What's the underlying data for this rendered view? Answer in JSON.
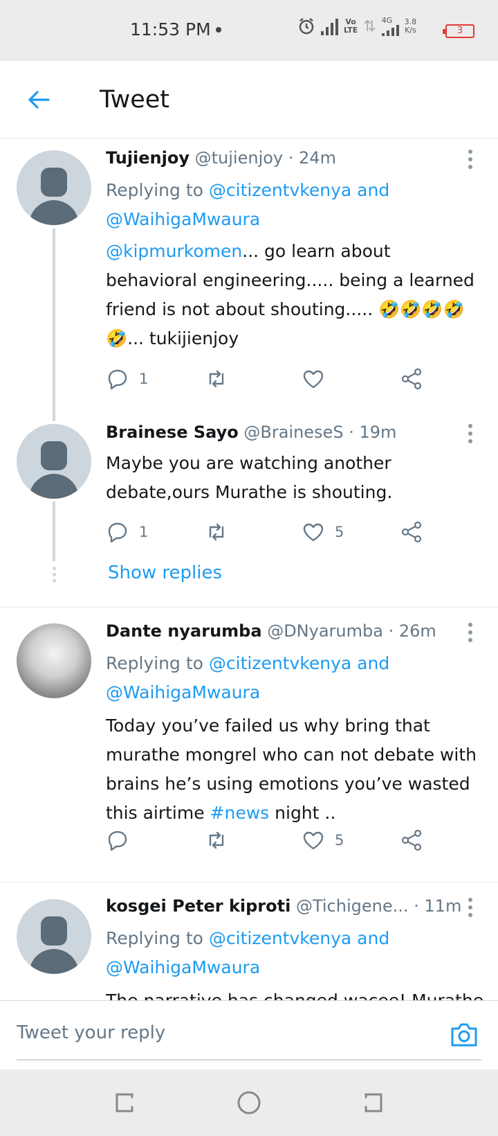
{
  "status_bar": {
    "time": "11:53 PM",
    "network_type": "4G",
    "volte_label": "Vo\nLTE",
    "speed": "3.8\nK/s",
    "battery": "3"
  },
  "header": {
    "title": "Tweet"
  },
  "tweets": [
    {
      "name": "Tujienjoy",
      "handle": "@tujienjoy",
      "time": "· 24m",
      "replying_prefix": "Replying to ",
      "replying_to": "@citizentvkenya and @WaihigaMwaura",
      "mention": "@kipmurkomen",
      "text": "... go learn about behavioral engineering..... being a learned friend is not about shouting..... 🤣🤣🤣🤣🤣... tukijienjoy",
      "reply_count": "1",
      "retweet_count": "",
      "like_count": ""
    },
    {
      "name": "Brainese Sayo",
      "handle": "@BraineseS",
      "time": "· 19m",
      "text": "Maybe you are watching another debate,ours Murathe is shouting.",
      "reply_count": "1",
      "retweet_count": "",
      "like_count": "5",
      "show_replies": "Show replies"
    },
    {
      "name": "Dante nyarumba",
      "handle": "@DNyarumba",
      "time": "· 26m",
      "replying_prefix": "Replying to ",
      "replying_to": "@citizentvkenya and @WaihigaMwaura",
      "text_before": "Today you’ve failed us why bring that murathe mongrel who can not debate with brains he’s using emotions you’ve wasted this airtime ",
      "hashtag": "#news",
      "text_after": " night ..",
      "reply_count": "",
      "retweet_count": "",
      "like_count": "5"
    },
    {
      "name": "kosgei Peter kiproti",
      "handle": "@Tichigene...",
      "time": "· 11m",
      "replying_prefix": "Replying to ",
      "replying_to": "@citizentvkenya and @WaihigaMwaura",
      "text": "The narrative has changed wacee! Murathe"
    }
  ],
  "reply_bar": {
    "placeholder": "Tweet your reply"
  },
  "icons": {
    "back": "back-arrow-icon",
    "reply": "reply-bubble-icon",
    "retweet": "retweet-icon",
    "like": "heart-icon",
    "share": "share-icon",
    "more": "more-vertical-icon",
    "camera": "camera-icon"
  },
  "colors": {
    "accent": "#1d9bf0",
    "muted": "#657786",
    "text": "#14171a",
    "battery": "#e53935"
  }
}
